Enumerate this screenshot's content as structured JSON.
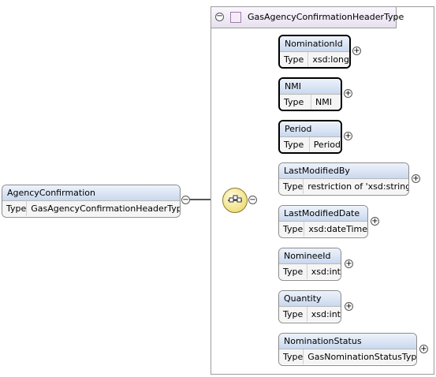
{
  "root": {
    "name": "AgencyConfirmation",
    "type_label": "Type",
    "type_value": "GasAgencyConfirmationHeaderType"
  },
  "complex_type": {
    "name": "GasAgencyConfirmationHeaderType"
  },
  "sequence": {
    "icon": "sequence-compositor-icon"
  },
  "elements": [
    {
      "name": "NominationId",
      "type_label": "Type",
      "type_value": "xsd:long"
    },
    {
      "name": "NMI",
      "type_label": "Type",
      "type_value": "NMI"
    },
    {
      "name": "Period",
      "type_label": "Type",
      "type_value": "Period"
    },
    {
      "name": "LastModifiedBy",
      "type_label": "Type",
      "type_value": "restriction of 'xsd:string'"
    },
    {
      "name": "LastModifiedDate",
      "type_label": "Type",
      "type_value": "xsd:dateTime"
    },
    {
      "name": "NomineeId",
      "type_label": "Type",
      "type_value": "xsd:int"
    },
    {
      "name": "Quantity",
      "type_label": "Type",
      "type_value": "xsd:int"
    },
    {
      "name": "NominationStatus",
      "type_label": "Type",
      "type_value": "GasNominationStatusType"
    }
  ],
  "expander_glyphs": {
    "plus": "+",
    "minus": "−"
  }
}
